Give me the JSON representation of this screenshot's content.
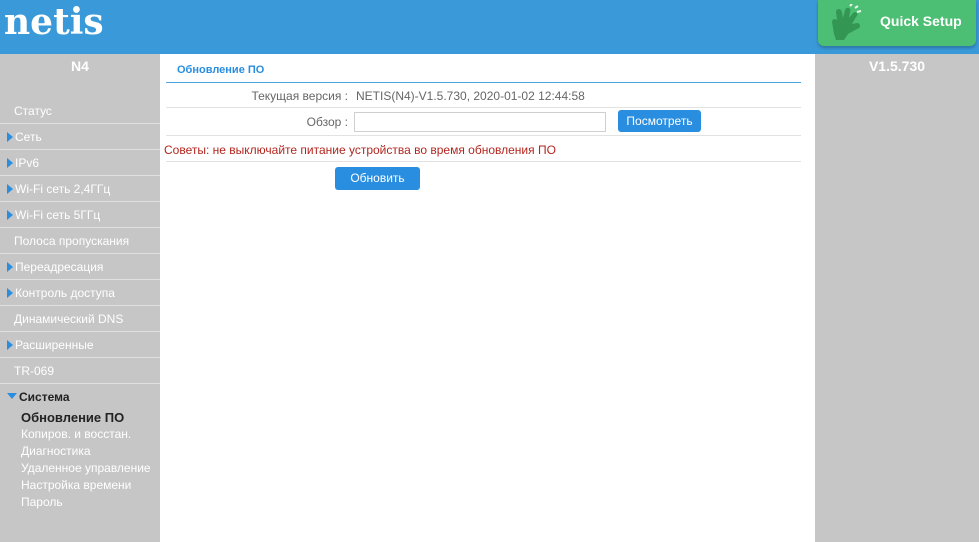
{
  "header": {
    "logo": "netis",
    "quick_setup_label": "Quick Setup"
  },
  "sidebar": {
    "model": "N4",
    "items": [
      {
        "label": "Статус",
        "arrow": false
      },
      {
        "label": "Сеть",
        "arrow": true
      },
      {
        "label": "IPv6",
        "arrow": true
      },
      {
        "label": "Wi-Fi сеть 2,4ГГц",
        "arrow": true
      },
      {
        "label": "Wi-Fi сеть 5ГГц",
        "arrow": true
      },
      {
        "label": "Полоса пропускания",
        "arrow": false
      },
      {
        "label": "Переадресация",
        "arrow": true
      },
      {
        "label": "Контроль доступа",
        "arrow": true
      },
      {
        "label": "Динамический DNS",
        "arrow": false
      },
      {
        "label": "Расширенные",
        "arrow": true
      },
      {
        "label": "TR-069",
        "arrow": false
      }
    ],
    "open_item": "Система",
    "sub_items": [
      {
        "label": "Обновление ПО",
        "active": true
      },
      {
        "label": "Копиров. и восстан."
      },
      {
        "label": "Диагностика"
      },
      {
        "label": "Удаленное управление"
      },
      {
        "label": "Настройка времени"
      },
      {
        "label": "Пароль"
      }
    ]
  },
  "rightbar": {
    "version": "V1.5.730"
  },
  "main": {
    "section_title": "Обновление ПО",
    "current_version_label": "Текущая версия :",
    "current_version_value": "NETIS(N4)-V1.5.730, 2020-01-02 12:44:58",
    "browse_label": "Обзор :",
    "browse_value": "",
    "view_button": "Посмотреть",
    "tip": "Советы: не выключайте питание устройства во время обновления ПО",
    "update_button": "Обновить"
  },
  "colors": {
    "header": "#3a9ad9",
    "quick_setup": "#4cbf74",
    "sidebar": "#c6c6c6",
    "accent": "#2a8ee0",
    "tip": "#b3261e"
  }
}
